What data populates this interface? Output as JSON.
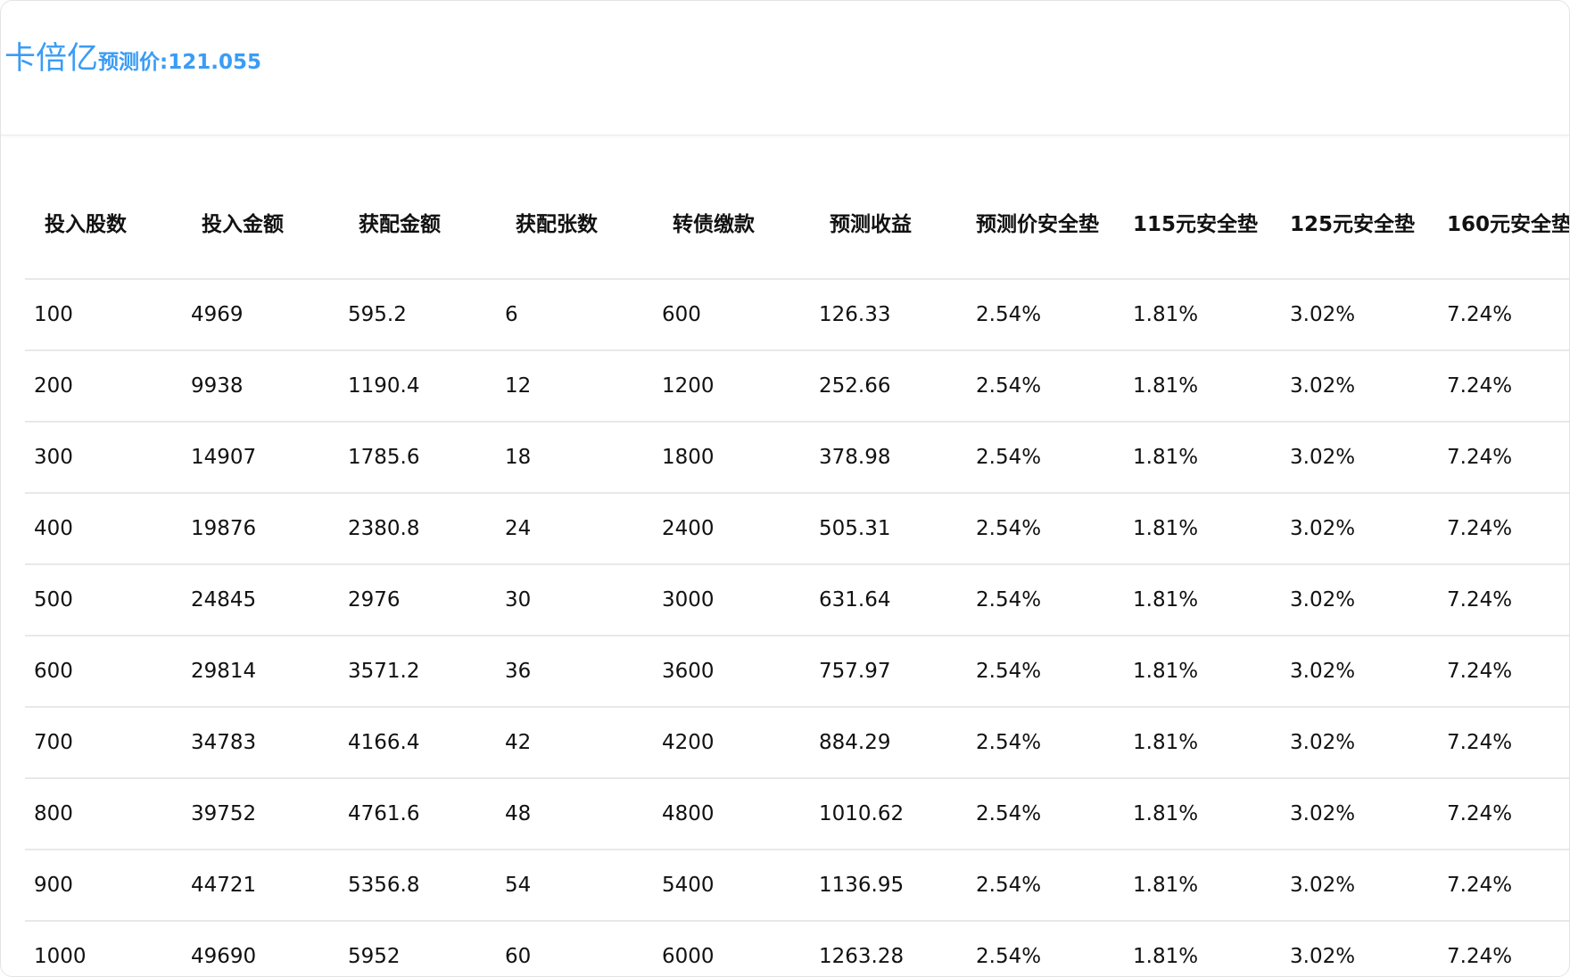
{
  "header": {
    "bond_name": "卡倍亿",
    "predicted_price_label": "预测价:",
    "predicted_price_value": "121.055"
  },
  "table": {
    "columns": [
      "投入股数",
      "投入金额",
      "获配金额",
      "获配张数",
      "转债缴款",
      "预测收益",
      "预测价安全垫",
      "115元安全垫",
      "125元安全垫",
      "160元安全垫"
    ],
    "rows": [
      [
        "100",
        "4969",
        "595.2",
        "6",
        "600",
        "126.33",
        "2.54%",
        "1.81%",
        "3.02%",
        "7.24%"
      ],
      [
        "200",
        "9938",
        "1190.4",
        "12",
        "1200",
        "252.66",
        "2.54%",
        "1.81%",
        "3.02%",
        "7.24%"
      ],
      [
        "300",
        "14907",
        "1785.6",
        "18",
        "1800",
        "378.98",
        "2.54%",
        "1.81%",
        "3.02%",
        "7.24%"
      ],
      [
        "400",
        "19876",
        "2380.8",
        "24",
        "2400",
        "505.31",
        "2.54%",
        "1.81%",
        "3.02%",
        "7.24%"
      ],
      [
        "500",
        "24845",
        "2976",
        "30",
        "3000",
        "631.64",
        "2.54%",
        "1.81%",
        "3.02%",
        "7.24%"
      ],
      [
        "600",
        "29814",
        "3571.2",
        "36",
        "3600",
        "757.97",
        "2.54%",
        "1.81%",
        "3.02%",
        "7.24%"
      ],
      [
        "700",
        "34783",
        "4166.4",
        "42",
        "4200",
        "884.29",
        "2.54%",
        "1.81%",
        "3.02%",
        "7.24%"
      ],
      [
        "800",
        "39752",
        "4761.6",
        "48",
        "4800",
        "1010.62",
        "2.54%",
        "1.81%",
        "3.02%",
        "7.24%"
      ],
      [
        "900",
        "44721",
        "5356.8",
        "54",
        "5400",
        "1136.95",
        "2.54%",
        "1.81%",
        "3.02%",
        "7.24%"
      ],
      [
        "1000",
        "49690",
        "5952",
        "60",
        "6000",
        "1263.28",
        "2.54%",
        "1.81%",
        "3.02%",
        "7.24%"
      ]
    ]
  },
  "colors": {
    "accent": "#3a9cf6",
    "text": "#111111",
    "divider": "#e8e8e8"
  }
}
